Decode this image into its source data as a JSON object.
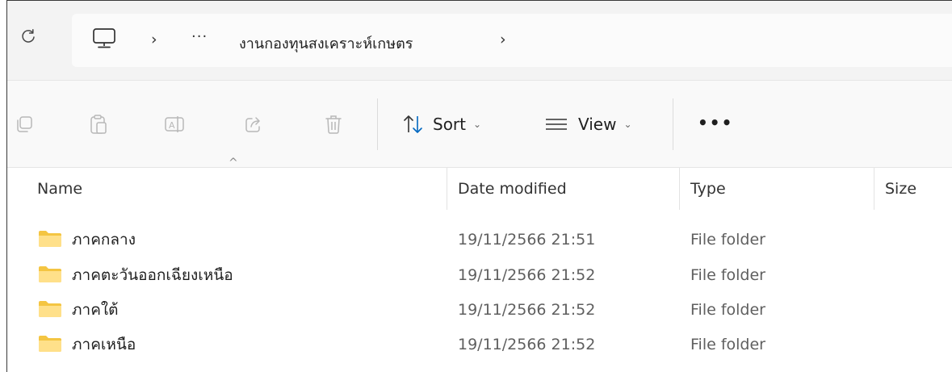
{
  "address_bar": {
    "folder": "งานกองทุนสงเคราะห์เกษตร",
    "more": "···",
    "chevron": "›"
  },
  "toolbar": {
    "sort_label": "Sort",
    "view_label": "View",
    "dropdown_caret": "⌄",
    "more_label": "•••"
  },
  "columns": {
    "name": "Name",
    "date": "Date modified",
    "type": "Type",
    "size": "Size",
    "sort_indicator": "^"
  },
  "files": [
    {
      "name": "ภาคกลาง",
      "date": "19/11/2566 21:51",
      "type": "File folder"
    },
    {
      "name": "ภาคตะวันออกเฉียงเหนือ",
      "date": "19/11/2566 21:52",
      "type": "File folder"
    },
    {
      "name": "ภาคใต้",
      "date": "19/11/2566 21:52",
      "type": "File folder"
    },
    {
      "name": "ภาคเหนือ",
      "date": "19/11/2566 21:52",
      "type": "File folder"
    }
  ],
  "colors": {
    "folder_yellow": "#f4c542",
    "folder_light": "#ffe08a",
    "disabled_icon": "#b8b8b8",
    "accent": "#0067c0"
  },
  "icons": {
    "refresh": "refresh-icon",
    "pc": "this-pc-icon",
    "copy": "copy-icon",
    "paste": "paste-icon",
    "rename": "rename-icon",
    "share": "share-icon",
    "delete": "delete-icon",
    "sort": "sort-icon",
    "view": "view-icon",
    "folder": "folder-icon"
  }
}
